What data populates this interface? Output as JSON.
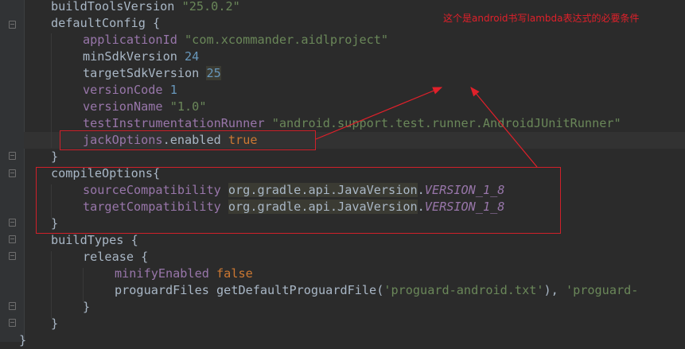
{
  "annotation": {
    "note": "这个是android书写lambda表达式的必要条件",
    "color": "#e0202a"
  },
  "code": {
    "l1": {
      "key": "buildToolsVersion",
      "value": "\"25.0.2\""
    },
    "l2": {
      "key": "defaultConfig",
      "brace": " {"
    },
    "l3": {
      "key": "applicationId",
      "value": "\"com.xcommander.aidlproject\""
    },
    "l4": {
      "key": "minSdkVersion",
      "value": "24"
    },
    "l5": {
      "key": "targetSdkVersion",
      "value": "25"
    },
    "l6": {
      "key": "versionCode",
      "value": "1"
    },
    "l7": {
      "key": "versionName",
      "value": "\"1.0\""
    },
    "l8": {
      "key": "testInstrumentationRunner",
      "value": "\"android.support.test.runner.AndroidJUnitRunner\""
    },
    "l9": {
      "key": "jackOptions",
      "mid": ".enabled",
      "value": "true"
    },
    "l10": {
      "brace": "}"
    },
    "l11": {
      "key": "compileOptions{"
    },
    "l12": {
      "key": "sourceCompatibility",
      "cls": "org.gradle.api.JavaVersion",
      "dot": ".",
      "value": "VERSION_1_8"
    },
    "l13": {
      "key": "targetCompatibility",
      "cls": "org.gradle.api.JavaVersion",
      "dot": ".",
      "value": "VERSION_1_8"
    },
    "l14": {
      "brace": "}"
    },
    "l15": {
      "key": "buildTypes",
      "brace": " {"
    },
    "l16": {
      "key": "release",
      "brace": " {"
    },
    "l17": {
      "key": "minifyEnabled",
      "value": "false"
    },
    "l18": {
      "key": "proguardFiles",
      "fn": "getDefaultProguardFile(",
      "arg1": "'proguard-android.txt'",
      "sep": "), ",
      "arg2": "'proguard-"
    },
    "l19": {
      "brace": "}"
    },
    "l20": {
      "brace": "}"
    },
    "l21": {
      "brace": "}"
    }
  }
}
